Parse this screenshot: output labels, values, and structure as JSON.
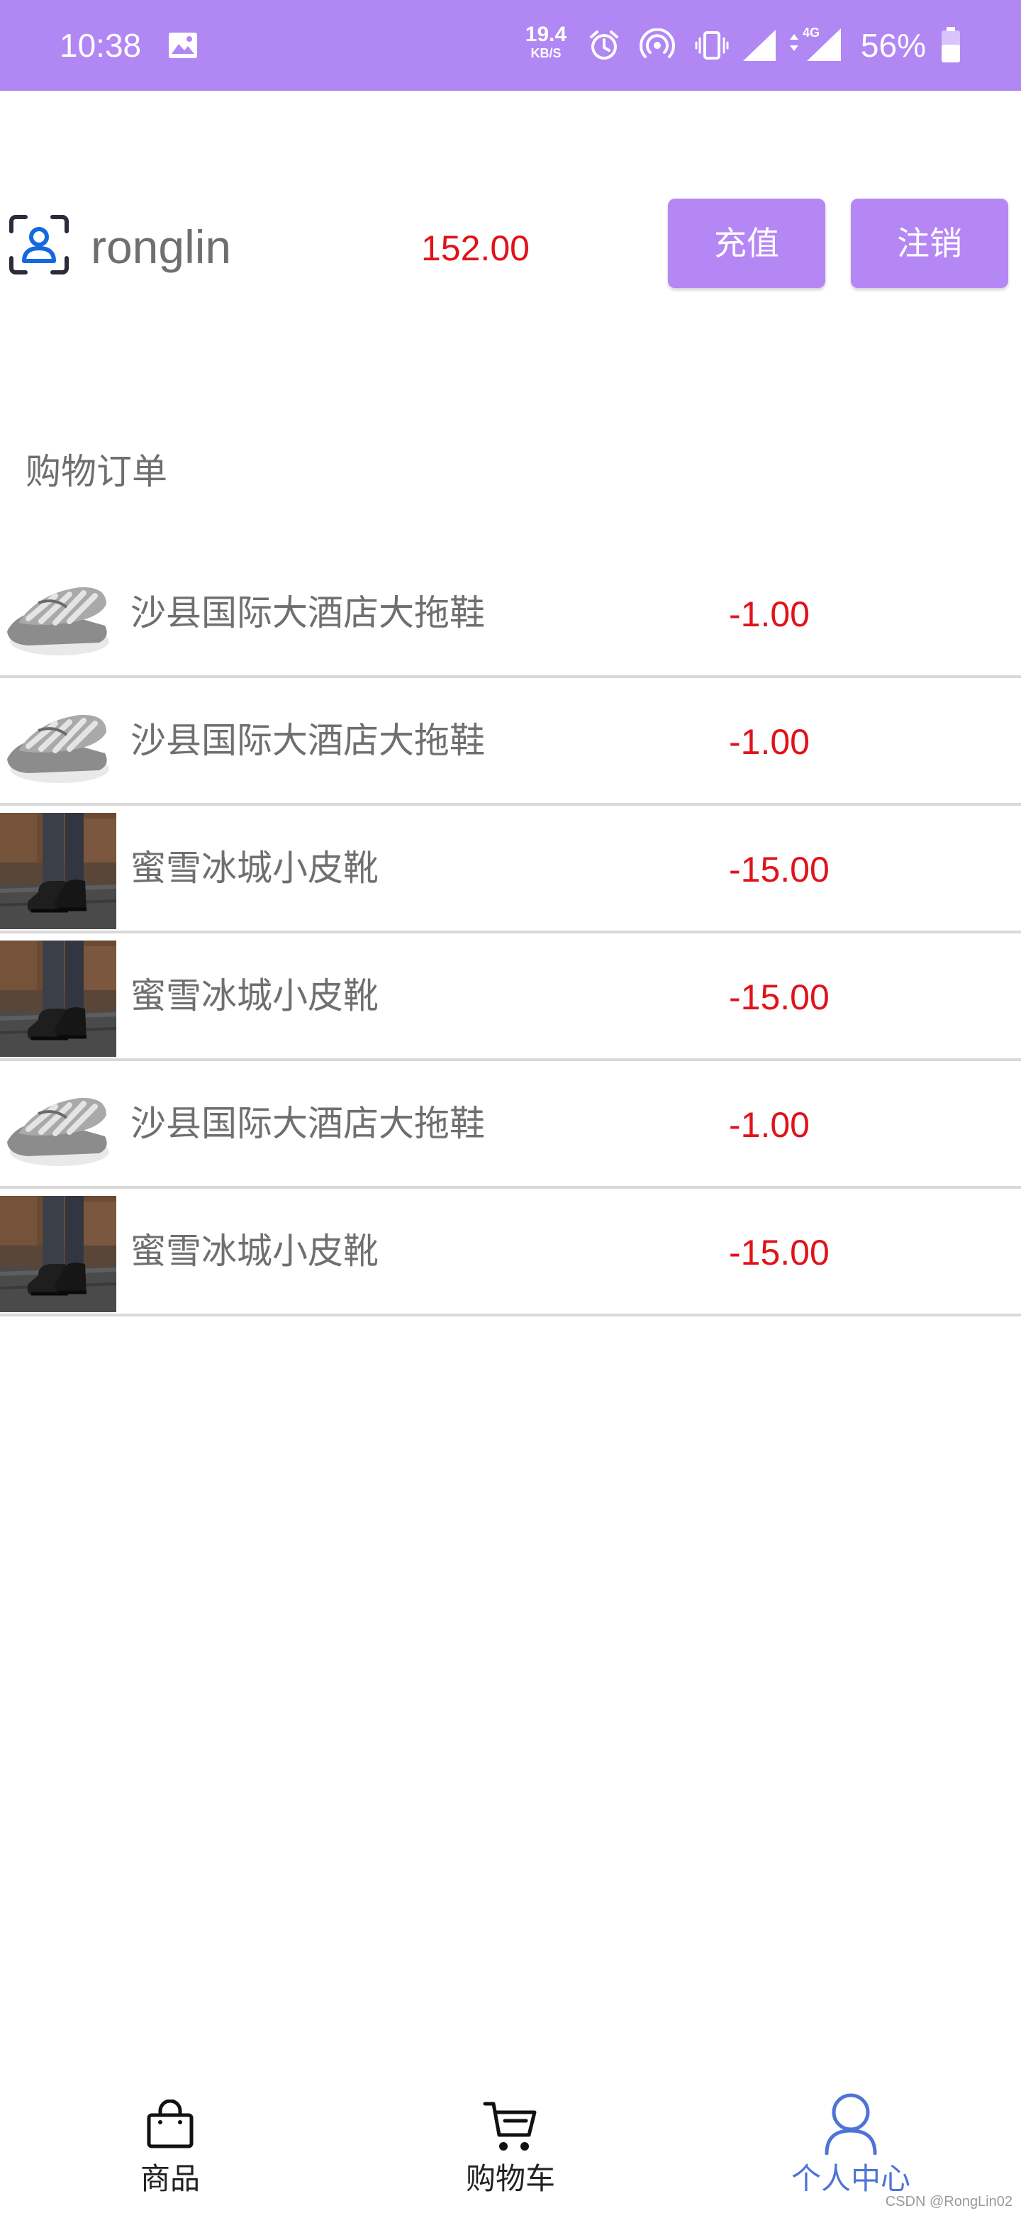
{
  "status_bar": {
    "time": "10:38",
    "network_speed_value": "19.4",
    "network_speed_unit": "KB/S",
    "network_type": "4G",
    "battery_percent": "56%",
    "background_color": "#b187f4"
  },
  "profile": {
    "username": "ronglin",
    "balance": "152.00",
    "recharge_label": "充值",
    "logout_label": "注销",
    "avatar_icon": "user-scan-icon"
  },
  "orders_section": {
    "title": "购物订单",
    "items": [
      {
        "name": "沙县国际大酒店大拖鞋",
        "price": "-1.00",
        "thumb": "slipper"
      },
      {
        "name": "沙县国际大酒店大拖鞋",
        "price": "-1.00",
        "thumb": "slipper"
      },
      {
        "name": "蜜雪冰城小皮靴",
        "price": "-15.00",
        "thumb": "boot"
      },
      {
        "name": "蜜雪冰城小皮靴",
        "price": "-15.00",
        "thumb": "boot"
      },
      {
        "name": "沙县国际大酒店大拖鞋",
        "price": "-1.00",
        "thumb": "slipper"
      },
      {
        "name": "蜜雪冰城小皮靴",
        "price": "-15.00",
        "thumb": "boot"
      }
    ]
  },
  "bottom_nav": {
    "items": [
      {
        "label": "商品",
        "icon": "shopping-bag-icon"
      },
      {
        "label": "购物车",
        "icon": "shopping-cart-icon"
      },
      {
        "label": "个人中心",
        "icon": "person-icon",
        "active": true
      }
    ],
    "active_color": "#4f74d6"
  },
  "watermark": "CSDN @RongLin02",
  "colors": {
    "accent": "#b587f5",
    "price_red": "#e0131a",
    "text_gray": "#6f6f6f"
  }
}
